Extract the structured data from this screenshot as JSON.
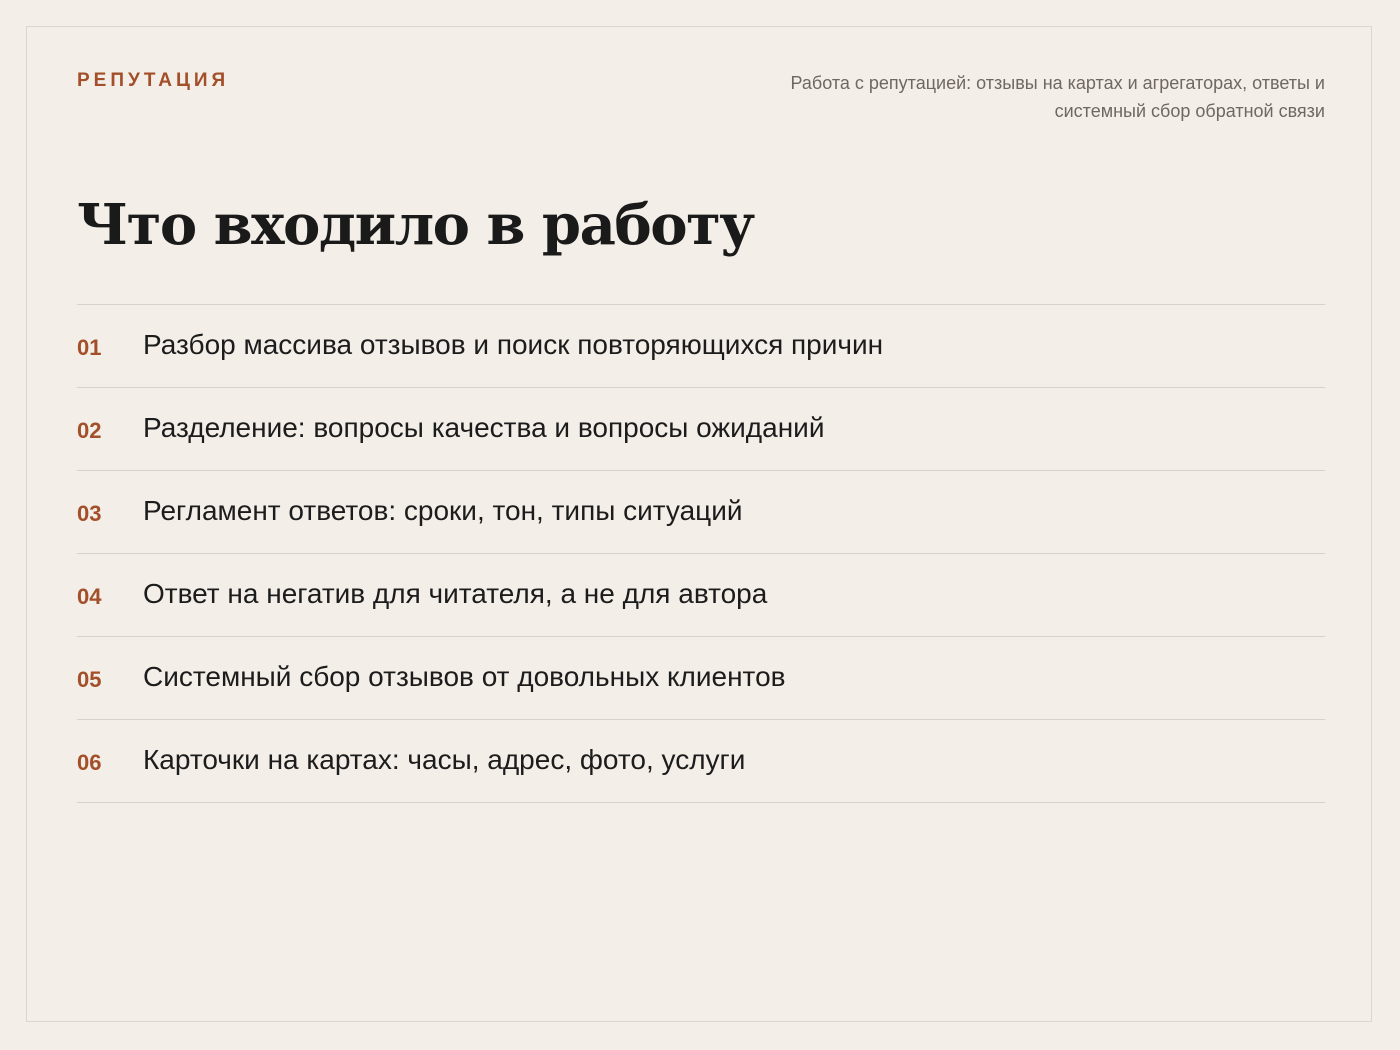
{
  "header": {
    "eyebrow": "РЕПУТАЦИЯ",
    "subtitle": "Работа с репутацией: отзывы на картах и агрегаторах, ответы и системный сбор обратной связи"
  },
  "main": {
    "title": "Что входило в работу",
    "items": [
      {
        "num": "01",
        "text": "Разбор массива отзывов и поиск повторяющихся причин"
      },
      {
        "num": "02",
        "text": "Разделение: вопросы качества и вопросы ожиданий"
      },
      {
        "num": "03",
        "text": "Регламент ответов: сроки, тон, типы ситуаций"
      },
      {
        "num": "04",
        "text": "Ответ на негатив для читателя, а не для автора"
      },
      {
        "num": "05",
        "text": "Системный сбор отзывов от довольных клиентов"
      },
      {
        "num": "06",
        "text": "Карточки на картах: часы, адрес, фото, услуги"
      }
    ]
  },
  "colors": {
    "background": "#f3eee8",
    "accent": "#a24f2a",
    "text": "#1c1c1c",
    "muted": "#6e6860",
    "divider": "#d9d2ca"
  }
}
